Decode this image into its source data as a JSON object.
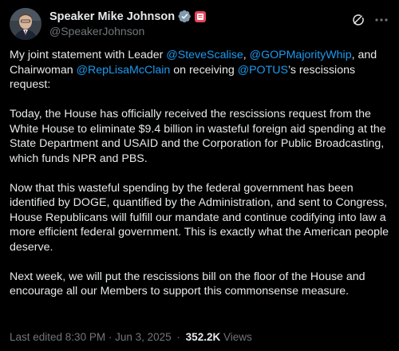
{
  "author": {
    "display_name": "Speaker Mike Johnson",
    "handle": "@SpeakerJohnson"
  },
  "icons": {
    "verified": "verified-badge-icon",
    "affiliate": "government-flag-icon",
    "grok": "grok-icon",
    "more": "more-options-icon"
  },
  "colors": {
    "background": "#000000",
    "text": "#e7e9ea",
    "secondary_text": "#71767b",
    "mention": "#1d9bf0",
    "verified_badge": "#829aab",
    "affiliate_badge": "#e8455a"
  },
  "post": {
    "p1": {
      "t1": "My joint statement with Leader ",
      "m1": "@SteveScalise",
      "t2": ", ",
      "m2": "@GOPMajorityWhip",
      "t3": ", and Chairwoman ",
      "m3": "@RepLisaMcClain",
      "t4": " on receiving ",
      "m4": "@POTUS",
      "t5": "’s rescissions request:"
    },
    "p2": "Today, the House has officially received the rescissions request from the White House to eliminate $9.4 billion in wasteful foreign aid spending at the State Department and USAID and the Corporation for Public Broadcasting, which funds NPR and PBS.",
    "p3": "Now that this wasteful spending by the federal government has been identified by DOGE, quantified by the Administration, and sent to Congress, House Republicans will fulfill our mandate and continue codifying into law a more efficient federal government. This is exactly what the American people deserve.",
    "p4": "Next week, we will put the rescissions bill on the floor of the House and encourage all our Members to support this commonsense measure."
  },
  "meta": {
    "edited": "Last edited 8:30 PM · Jun 3, 2025",
    "separator": "·",
    "views_count": "352.2K",
    "views_label": "Views"
  }
}
